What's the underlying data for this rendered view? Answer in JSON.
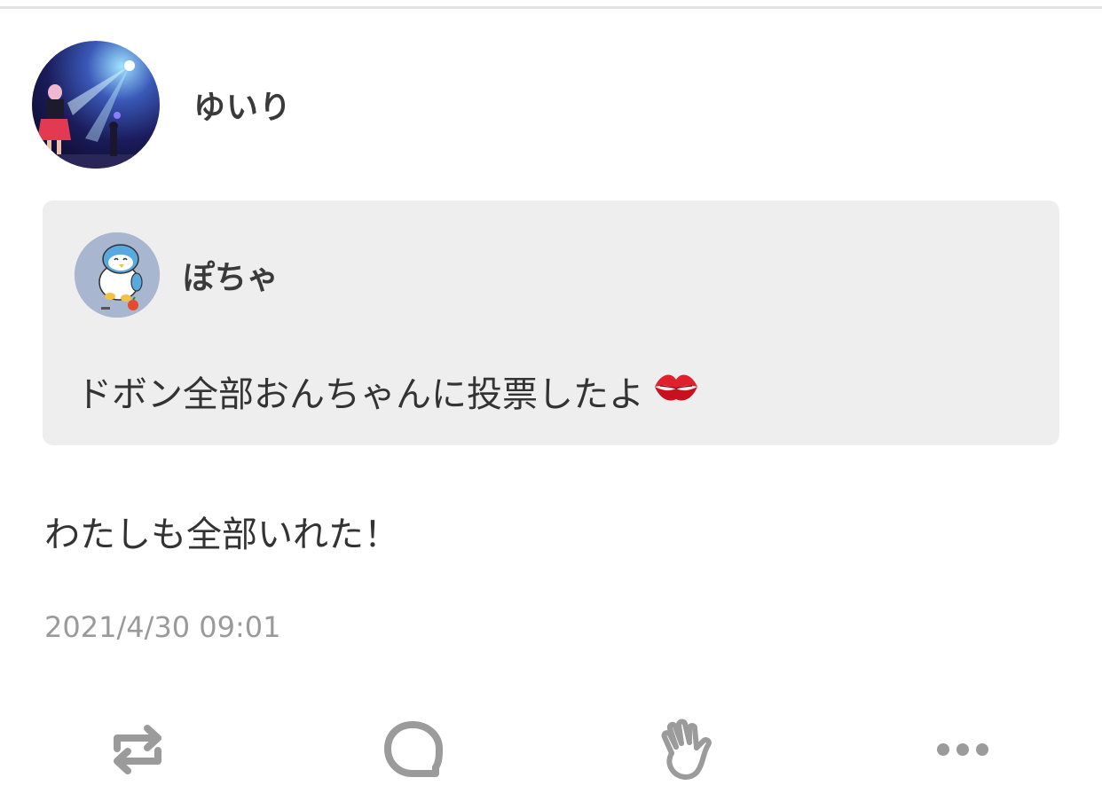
{
  "post": {
    "author": "ゆいり",
    "text": "わたしも全部いれた！",
    "timestamp": "2021/4/30 09:01"
  },
  "quote": {
    "author": "ぽちゃ",
    "text": "ドボン全部おんちゃんに投票したよ"
  },
  "actions": [
    {
      "name": "repost",
      "icon": "repost-icon"
    },
    {
      "name": "reply",
      "icon": "speech-bubble-icon"
    },
    {
      "name": "clap",
      "icon": "clap-hand-icon"
    },
    {
      "name": "more",
      "icon": "more-dots-icon"
    }
  ],
  "colors": {
    "text": "#333333",
    "muted": "#9a9a9a",
    "icon": "#9b9b9b",
    "quote_bg": "#eeeeee",
    "divider": "#e2e2e2"
  }
}
